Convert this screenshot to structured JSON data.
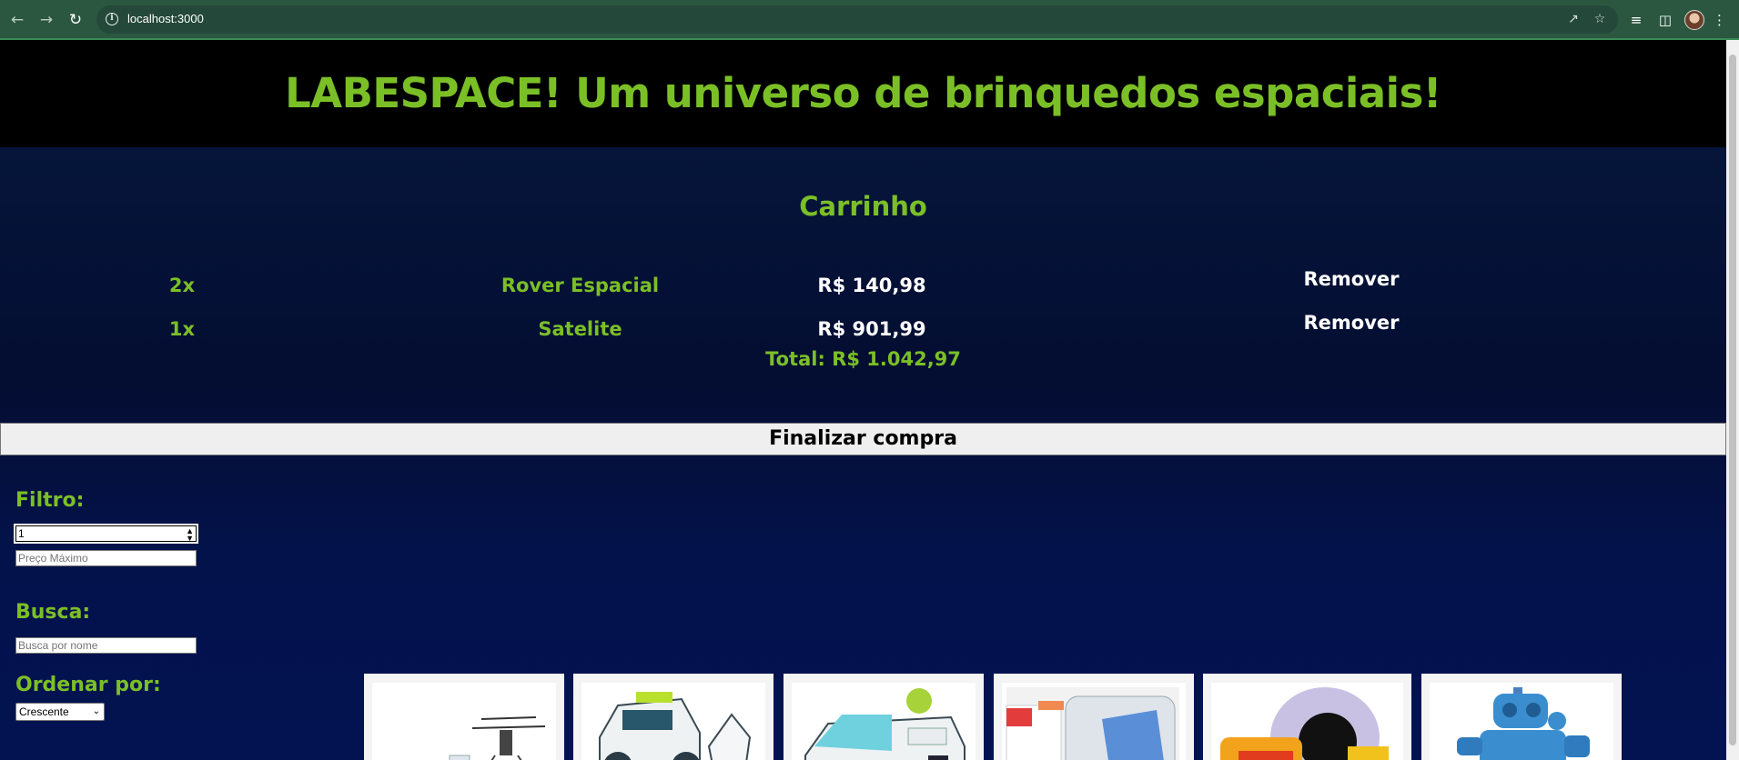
{
  "browser": {
    "url": "localhost:3000"
  },
  "header": {
    "title": "LABESPACE! Um universo de brinquedos espaciais!"
  },
  "cart": {
    "title": "Carrinho",
    "items": [
      {
        "qty": "2x",
        "name": "Rover Espacial",
        "price": "R$ 140,98",
        "remove_label": "Remover"
      },
      {
        "qty": "1x",
        "name": "Satelite",
        "price": "R$ 901,99",
        "remove_label": "Remover"
      }
    ],
    "total": "Total: R$ 1.042,97",
    "checkout_label": "Finalizar compra"
  },
  "filters": {
    "filter_label": "Filtro:",
    "min_value": "1",
    "max_placeholder": "Preço Máximo",
    "search_label": "Busca:",
    "search_placeholder": "Busca por nome",
    "sort_label": "Ordenar por:",
    "sort_selected": "Crescente"
  },
  "products": [
    {
      "icon": "helicopter-drone-toy"
    },
    {
      "icon": "white-rover-toy"
    },
    {
      "icon": "space-vehicle-toy"
    },
    {
      "icon": "shuttle-cabin-toy"
    },
    {
      "icon": "astronaut-toy"
    },
    {
      "icon": "blue-robot-toy"
    }
  ],
  "colors": {
    "accent": "#7bbf27",
    "background": "#040d32",
    "header_bg": "#000000"
  }
}
